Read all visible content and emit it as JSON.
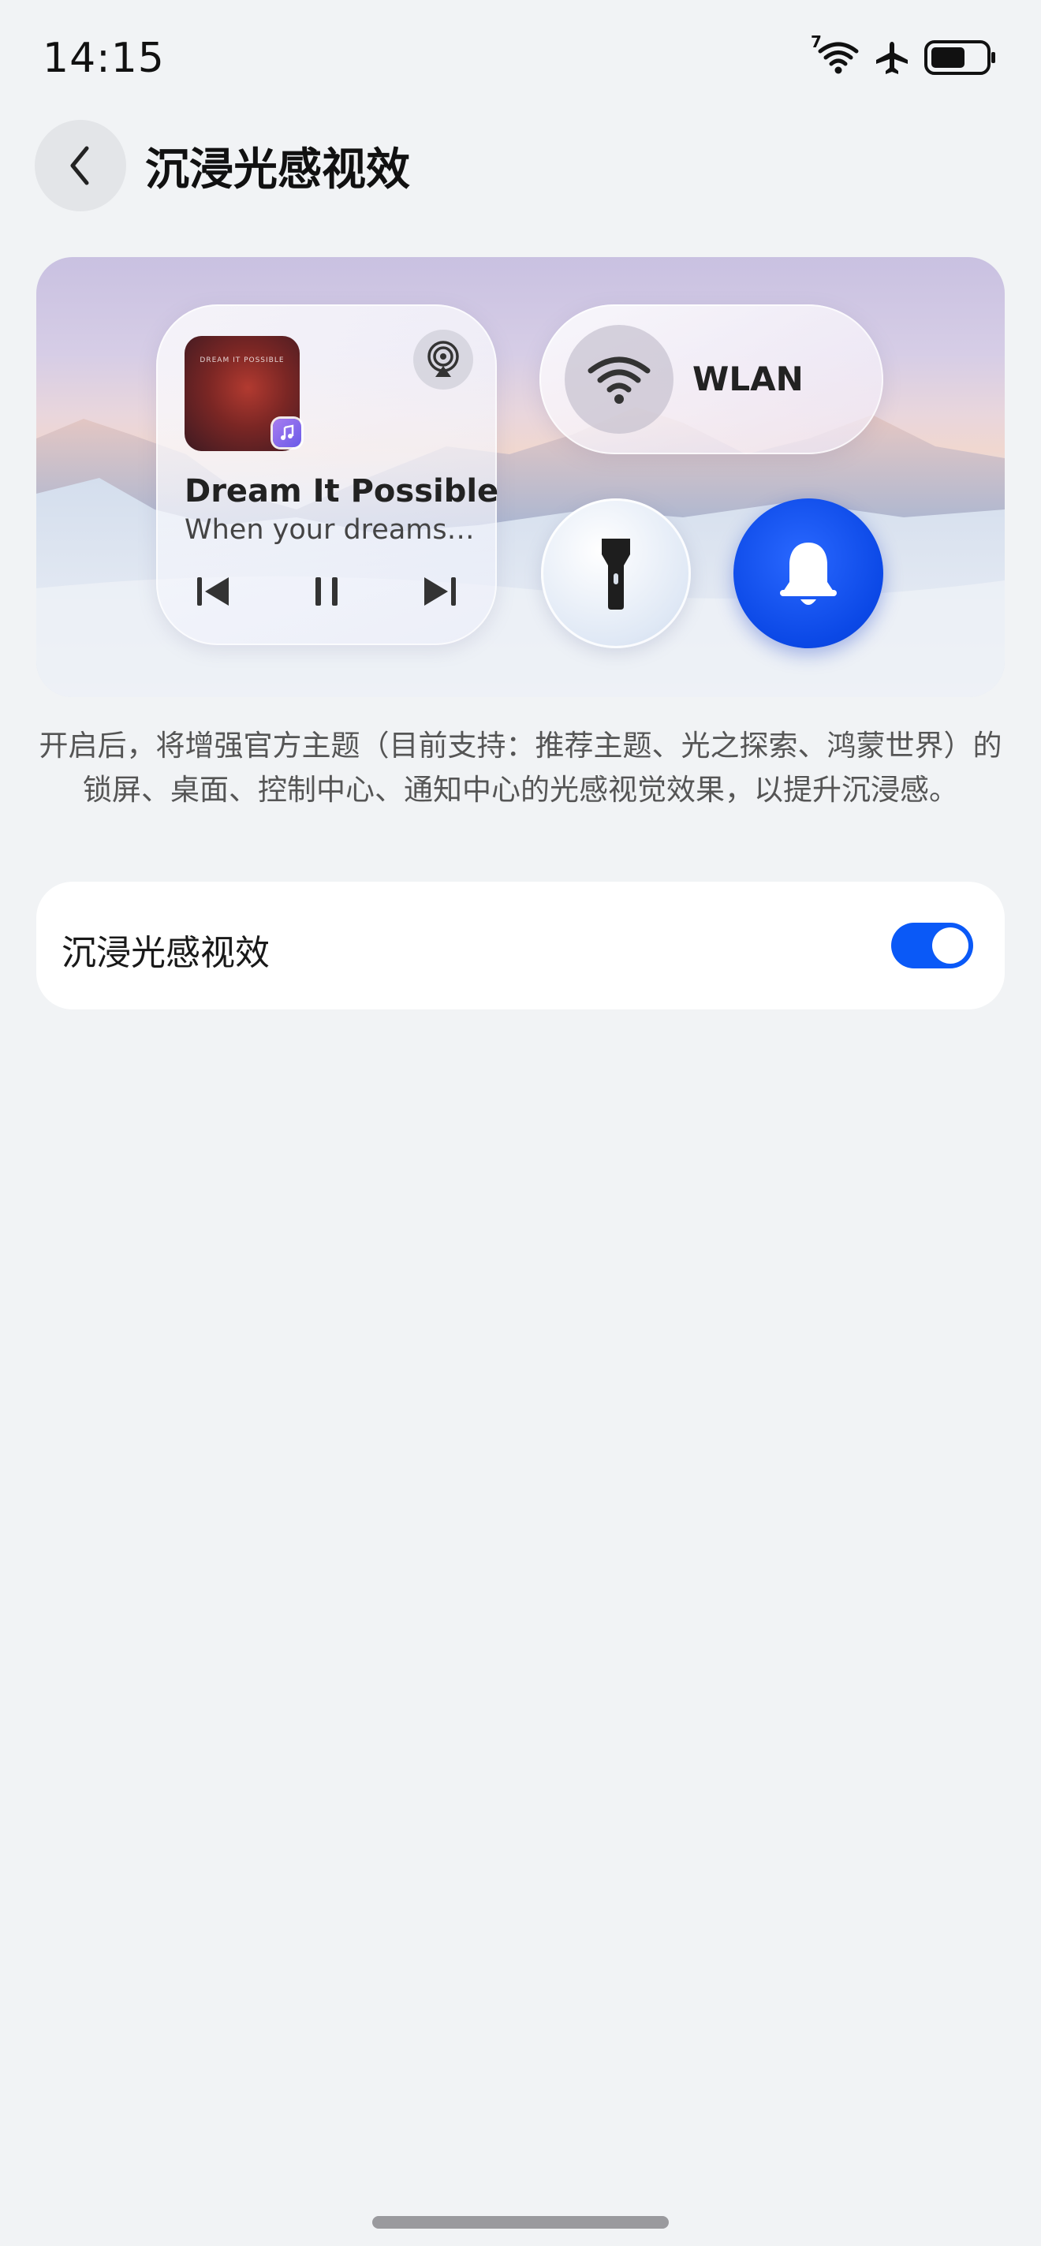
{
  "status_bar": {
    "time": "14:15",
    "wifi_badge": "7",
    "icons": [
      "wifi-icon",
      "airplane-icon",
      "battery-icon"
    ]
  },
  "header": {
    "back_icon": "chevron-left-icon",
    "title": "沉浸光感视效"
  },
  "preview": {
    "media": {
      "album_text": "DREAM IT POSSIBLE",
      "title": "Dream It Possible",
      "subtitle": "When your dreams…",
      "controls": [
        "previous-icon",
        "pause-icon",
        "next-icon"
      ],
      "cast_icon": "audio-cast-icon"
    },
    "wlan": {
      "label": "WLAN",
      "icon": "wifi-icon"
    },
    "flashlight_icon": "flashlight-icon",
    "bell_icon": "bell-icon",
    "accent_color": "#0a59f7"
  },
  "description": "开启后，将增强官方主题（目前支持：推荐主题、光之探索、鸿蒙世界）的锁屏、桌面、控制中心、通知中心的光感视觉效果，以提升沉浸感。",
  "setting": {
    "label": "沉浸光感视效",
    "enabled": true,
    "toggle_color": "#0a59f7"
  }
}
